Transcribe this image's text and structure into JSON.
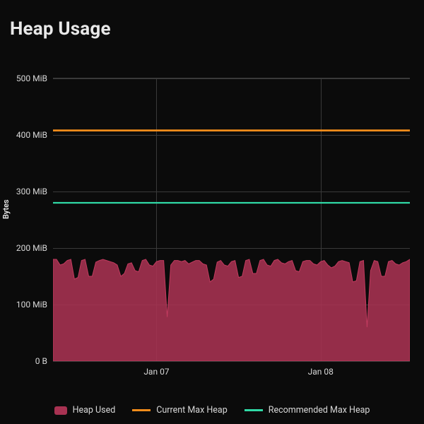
{
  "title": "Heap Usage",
  "ylabel": "Bytes",
  "y_ticks": [
    {
      "pos": 0,
      "label": "0 B"
    },
    {
      "pos": 100,
      "label": "100 MiB"
    },
    {
      "pos": 200,
      "label": "200 MiB"
    },
    {
      "pos": 300,
      "label": "300 MiB"
    },
    {
      "pos": 400,
      "label": "400 MiB"
    },
    {
      "pos": 500,
      "label": "500 MiB"
    }
  ],
  "x_ticks": [
    {
      "x": 29,
      "label": "Jan 07"
    },
    {
      "x": 75,
      "label": "Jan 08"
    }
  ],
  "legend": {
    "heap_used": "Heap Used",
    "current_max": "Current Max Heap",
    "recommended_max": "Recommended Max Heap"
  },
  "colors": {
    "heap_used": "#a83252",
    "current_max": "#f28c1b",
    "recommended_max": "#30d9a6",
    "grid": "#3a3a3a",
    "background": "#0b0b0b"
  },
  "chart_data": {
    "type": "area",
    "title": "Heap Usage",
    "xlabel": "",
    "ylabel": "Bytes",
    "ylim": [
      0,
      500
    ],
    "y_unit": "MiB",
    "x_range_label": [
      "Jan 07",
      "Jan 08"
    ],
    "series": [
      {
        "name": "Heap Used",
        "type": "area",
        "x": [
          0,
          1,
          2,
          3,
          4,
          5,
          6,
          7,
          8,
          9,
          10,
          11,
          12,
          13,
          14,
          15,
          16,
          17,
          18,
          19,
          20,
          21,
          22,
          23,
          24,
          25,
          26,
          27,
          28,
          29,
          30,
          31,
          32,
          33,
          34,
          35,
          36,
          37,
          38,
          39,
          40,
          41,
          42,
          43,
          44,
          45,
          46,
          47,
          48,
          49,
          50,
          51,
          52,
          53,
          54,
          55,
          56,
          57,
          58,
          59,
          60,
          61,
          62,
          63,
          64,
          65,
          66,
          67,
          68,
          69,
          70,
          71,
          72,
          73,
          74,
          75,
          76,
          77,
          78,
          79,
          80,
          81,
          82,
          83,
          84,
          85,
          86,
          87,
          88,
          89,
          90,
          91,
          92,
          93,
          94,
          95,
          96,
          97,
          98,
          99,
          100
        ],
        "values": [
          180,
          180,
          170,
          172,
          178,
          180,
          145,
          148,
          178,
          180,
          150,
          150,
          175,
          178,
          180,
          178,
          176,
          174,
          170,
          150,
          155,
          172,
          174,
          160,
          158,
          178,
          180,
          170,
          168,
          176,
          178,
          178,
          78,
          170,
          178,
          178,
          176,
          178,
          172,
          175,
          178,
          178,
          172,
          170,
          140,
          145,
          175,
          178,
          170,
          168,
          176,
          178,
          148,
          150,
          178,
          180,
          155,
          155,
          178,
          180,
          170,
          168,
          178,
          180,
          174,
          172,
          176,
          178,
          160,
          158,
          176,
          178,
          178,
          172,
          170,
          176,
          178,
          170,
          165,
          168,
          176,
          178,
          176,
          174,
          140,
          142,
          176,
          178,
          60,
          160,
          178,
          176,
          150,
          150,
          176,
          178,
          172,
          170,
          174,
          176,
          180
        ]
      },
      {
        "name": "Current Max Heap",
        "type": "line",
        "constant": 408
      },
      {
        "name": "Recommended Max Heap",
        "type": "line",
        "constant": 280
      }
    ],
    "legend_position": "bottom",
    "grid": true
  }
}
